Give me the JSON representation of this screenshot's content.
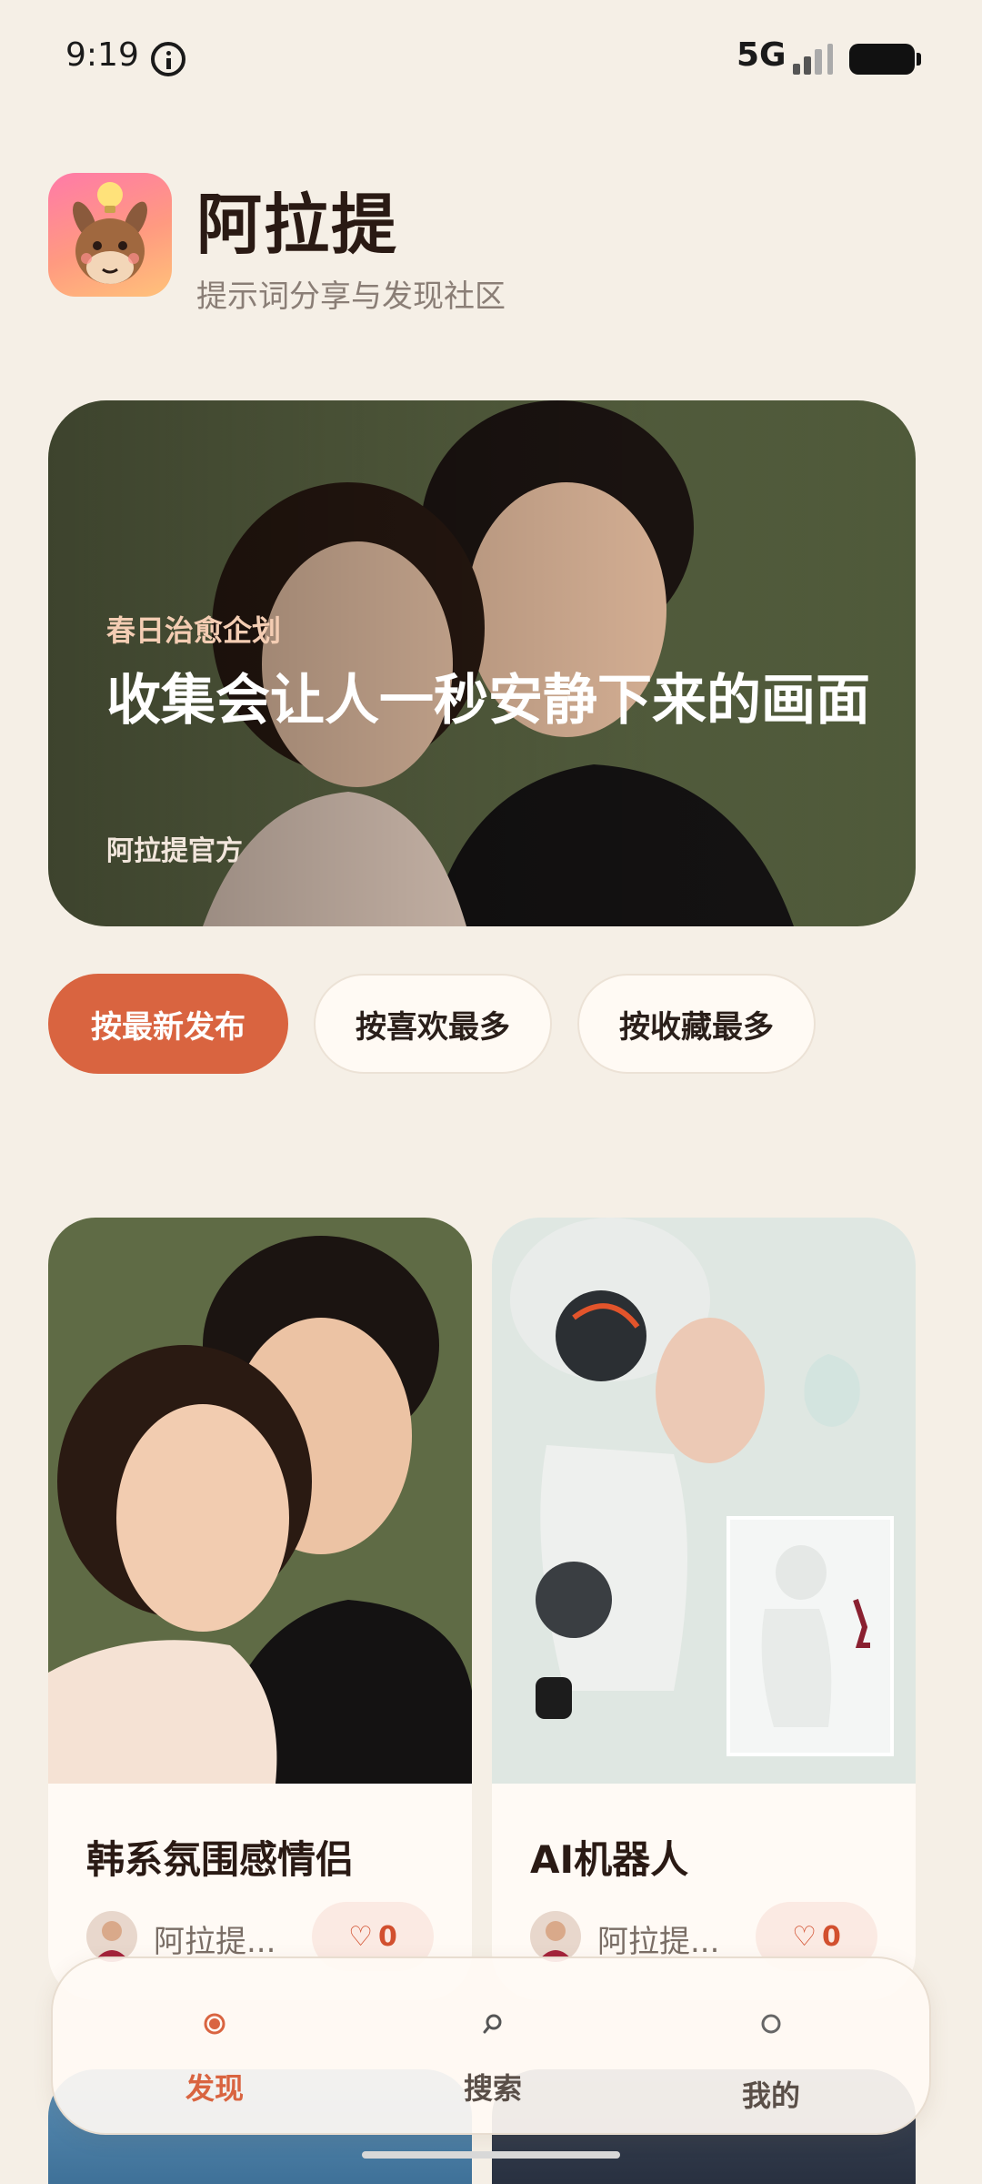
{
  "status_bar": {
    "time": "9:19",
    "network": "5G"
  },
  "header": {
    "title": "阿拉提",
    "subtitle": "提示词分享与发现社区"
  },
  "hero": {
    "tag": "春日治愈企划",
    "title": "收集会让人一秒安静下来的画面",
    "author": "阿拉提官方"
  },
  "sort_tabs": [
    {
      "label": "按最新发布",
      "active": true
    },
    {
      "label": "按喜欢最多",
      "active": false
    },
    {
      "label": "按收藏最多",
      "active": false
    }
  ],
  "cards": [
    {
      "title": "韩系氛围感情侣",
      "author": "阿拉提...",
      "likes": "0"
    },
    {
      "title": "AI机器人",
      "author": "阿拉提...",
      "likes": "0"
    }
  ],
  "bottom_nav": [
    {
      "label": "发现",
      "active": true,
      "icon": "discover-icon"
    },
    {
      "label": "搜索",
      "active": false,
      "icon": "search-icon"
    },
    {
      "label": "我的",
      "active": false,
      "icon": "profile-icon"
    }
  ],
  "colors": {
    "accent": "#d96440",
    "background": "#f5efe6",
    "card": "#fffaf5"
  }
}
